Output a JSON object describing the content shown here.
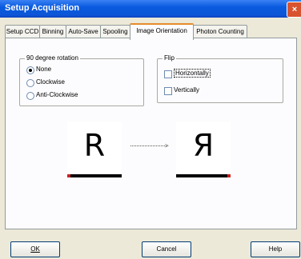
{
  "window": {
    "title": "Setup Acquisition",
    "close_label": "×"
  },
  "tabs": [
    {
      "label": "Setup CCD",
      "active": false
    },
    {
      "label": "Binning",
      "active": false
    },
    {
      "label": "Auto-Save",
      "active": false
    },
    {
      "label": "Spooling",
      "active": false
    },
    {
      "label": "Image Orientation",
      "active": true
    },
    {
      "label": "Photon Counting",
      "active": false
    }
  ],
  "rotation": {
    "legend": "90 degree rotation",
    "options": [
      "None",
      "Clockwise",
      "Anti-Clockwise"
    ],
    "selected": "None"
  },
  "flip": {
    "legend": "Flip",
    "options": [
      "Horizontally",
      "Vertically"
    ]
  },
  "preview": {
    "before": "R",
    "after": "Я",
    "arrow": ">"
  },
  "buttons": {
    "ok": "OK",
    "cancel": "Cancel",
    "help": "Help"
  }
}
